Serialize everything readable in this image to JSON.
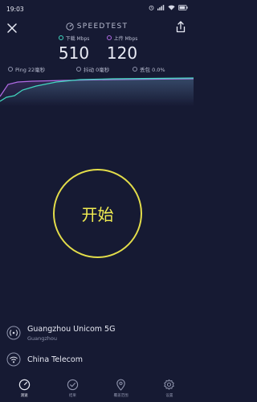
{
  "status_bar": {
    "time": "19:03"
  },
  "header": {
    "brand": "SPEEDTEST"
  },
  "speed": {
    "download": {
      "label": "下载 Mbps",
      "value": "510",
      "color": "#41d9c0"
    },
    "upload": {
      "label": "上传 Mbps",
      "value": "120",
      "color": "#b16ce6"
    }
  },
  "stats": {
    "ping": "Ping 22毫秒",
    "jitter": "抖动 0毫秒",
    "loss": "丢包 0.0%"
  },
  "start_button": {
    "label": "开始",
    "color": "#e3dd4a"
  },
  "server": {
    "name": "Guangzhou Unicom 5G",
    "location": "Guangzhou"
  },
  "isp": {
    "name": "China Telecom"
  },
  "bottom_nav": [
    {
      "label": "测速",
      "icon": "speedometer-icon",
      "active": true
    },
    {
      "label": "结果",
      "icon": "check-circle-icon",
      "active": false
    },
    {
      "label": "覆盖范围",
      "icon": "map-pin-icon",
      "active": false
    },
    {
      "label": "设置",
      "icon": "gear-icon",
      "active": false
    }
  ]
}
